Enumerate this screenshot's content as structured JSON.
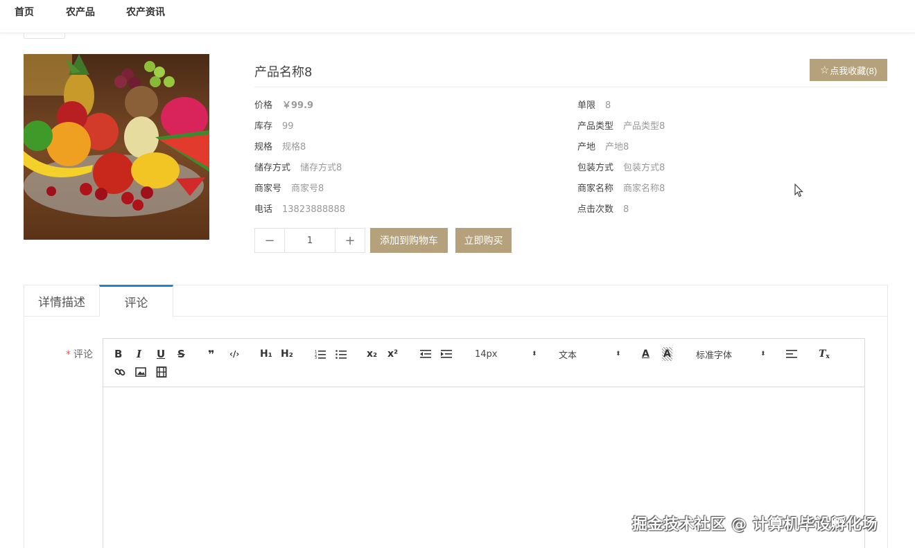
{
  "nav": {
    "items": [
      "首页",
      "农产品",
      "农产资讯"
    ]
  },
  "product": {
    "name": "产品名称8",
    "favorite_label": "点我收藏(8)",
    "attrs_left": [
      {
        "label": "价格",
        "value": "￥99.9"
      },
      {
        "label": "库存",
        "value": "99"
      },
      {
        "label": "规格",
        "value": "规格8"
      },
      {
        "label": "储存方式",
        "value": "储存方式8"
      },
      {
        "label": "商家号",
        "value": "商家号8"
      },
      {
        "label": "电话",
        "value": "13823888888"
      }
    ],
    "attrs_right": [
      {
        "label": "单限",
        "value": "8"
      },
      {
        "label": "产品类型",
        "value": "产品类型8"
      },
      {
        "label": "产地",
        "value": "产地8"
      },
      {
        "label": "包装方式",
        "value": "包装方式8"
      },
      {
        "label": "商家名称",
        "value": "商家名称8"
      },
      {
        "label": "点击次数",
        "value": "8"
      }
    ],
    "quantity": "1",
    "minus_symbol": "−",
    "plus_symbol": "+",
    "add_cart_label": "添加到购物车",
    "buy_now_label": "立即购买"
  },
  "tabs": [
    {
      "label": "详情描述",
      "active": false
    },
    {
      "label": "评论",
      "active": true
    }
  ],
  "comment": {
    "required_mark": "*",
    "label": "评论"
  },
  "editor": {
    "font_size": "14px",
    "header_style": "文本",
    "font_family": "标准字体",
    "buttons": {
      "bold": "B",
      "italic": "I",
      "underline": "U",
      "strike": "S",
      "blockquote": "❞",
      "code": "‹/›",
      "h1": "H₁",
      "h2": "H₂",
      "subscript": "x₂",
      "superscript": "x²",
      "color": "A",
      "background": "A",
      "clean": "T"
    }
  },
  "watermark": "掘金技术社区 @ 计算机毕设孵化场"
}
